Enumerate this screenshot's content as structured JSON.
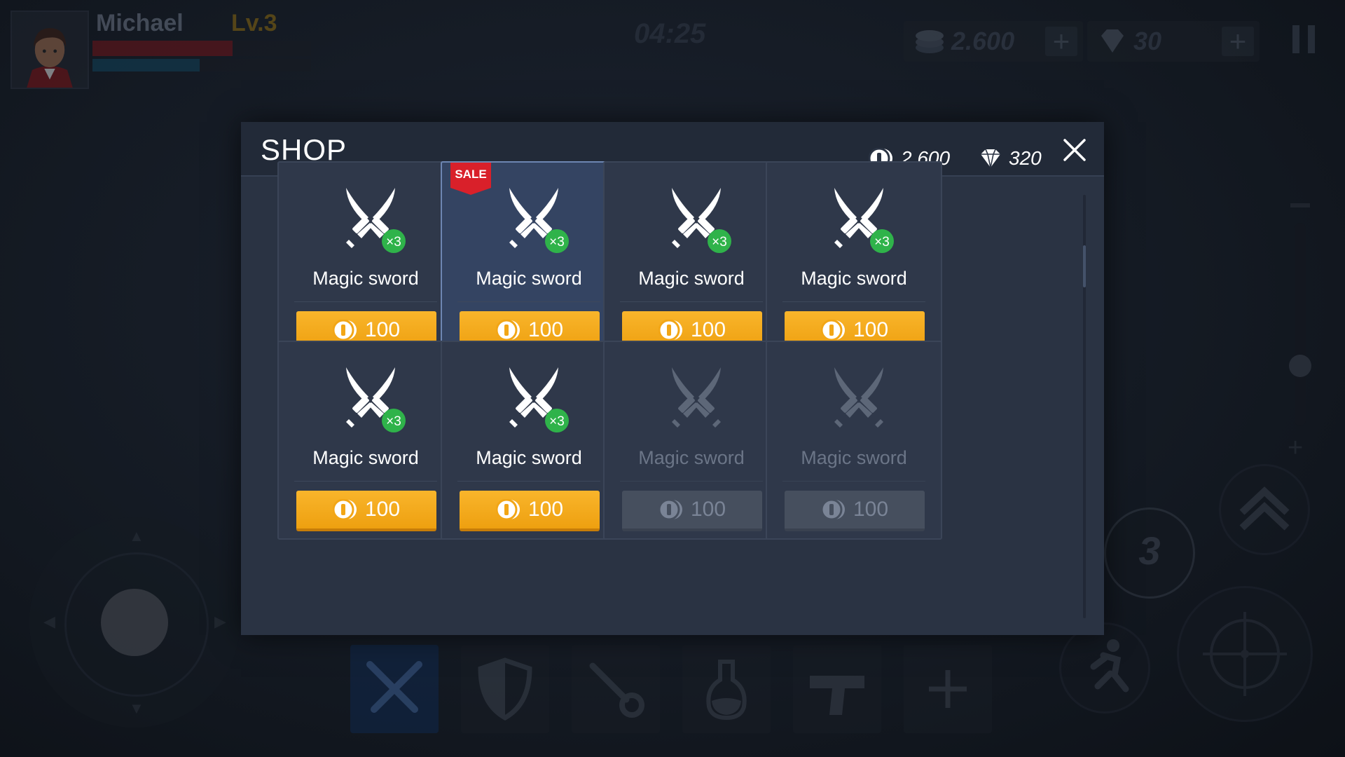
{
  "hud": {
    "player_name": "Michael",
    "player_level": "Lv.3",
    "health_fraction": 0.64,
    "mana_fraction": 0.49,
    "timer": "04:25",
    "coins": "2.600",
    "gems": "30",
    "add_label": "+",
    "skill_charges": "3",
    "inventory_slots": [
      "swords-icon",
      "shield-icon",
      "key-icon",
      "potion-icon",
      "pistol-icon",
      "plus-icon"
    ]
  },
  "shop": {
    "title": "SHOP",
    "coins": "2.600",
    "gems": "320",
    "sale_label": "SALE",
    "items": [
      {
        "name": "Magic sword",
        "price": "100",
        "quantity": "×3",
        "sale": false,
        "selected": false,
        "disabled": false
      },
      {
        "name": "Magic sword",
        "price": "100",
        "quantity": "×3",
        "sale": true,
        "selected": true,
        "disabled": false
      },
      {
        "name": "Magic sword",
        "price": "100",
        "quantity": "×3",
        "sale": false,
        "selected": false,
        "disabled": false
      },
      {
        "name": "Magic sword",
        "price": "100",
        "quantity": "×3",
        "sale": false,
        "selected": false,
        "disabled": false
      },
      {
        "name": "Magic sword",
        "price": "100",
        "quantity": "×3",
        "sale": false,
        "selected": false,
        "disabled": false
      },
      {
        "name": "Magic sword",
        "price": "100",
        "quantity": "×3",
        "sale": false,
        "selected": false,
        "disabled": false
      },
      {
        "name": "Magic sword",
        "price": "100",
        "quantity": "",
        "sale": false,
        "selected": false,
        "disabled": true
      },
      {
        "name": "Magic sword",
        "price": "100",
        "quantity": "",
        "sale": false,
        "selected": false,
        "disabled": true
      }
    ]
  },
  "colors": {
    "accent_gold": "#f5ab1e",
    "badge_green": "#2fb34a",
    "sale_red": "#d9202a"
  }
}
